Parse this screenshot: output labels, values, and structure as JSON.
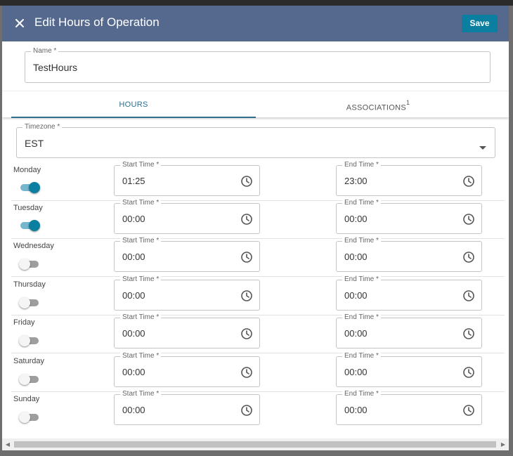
{
  "dialog": {
    "title": "Edit Hours of Operation",
    "save_label": "Save",
    "close_icon": "close-icon"
  },
  "name_field": {
    "label": "Name *",
    "value": "TestHours"
  },
  "tabs": [
    {
      "label": "HOURS",
      "active": true,
      "badge": ""
    },
    {
      "label": "ASSOCIATIONS",
      "active": false,
      "badge": "1"
    }
  ],
  "timezone": {
    "label": "Timezone *",
    "value": "EST"
  },
  "field_labels": {
    "start": "Start Time *",
    "end": "End Time *"
  },
  "days": [
    {
      "name": "Monday",
      "enabled": true,
      "start": "01:25",
      "end": "23:00"
    },
    {
      "name": "Tuesday",
      "enabled": true,
      "start": "00:00",
      "end": "00:00"
    },
    {
      "name": "Wednesday",
      "enabled": false,
      "start": "00:00",
      "end": "00:00"
    },
    {
      "name": "Thursday",
      "enabled": false,
      "start": "00:00",
      "end": "00:00"
    },
    {
      "name": "Friday",
      "enabled": false,
      "start": "00:00",
      "end": "00:00"
    },
    {
      "name": "Saturday",
      "enabled": false,
      "start": "00:00",
      "end": "00:00"
    },
    {
      "name": "Sunday",
      "enabled": false,
      "start": "00:00",
      "end": "00:00"
    }
  ],
  "colors": {
    "header": "#54698d",
    "accent": "#0a7fa0",
    "tab_active": "#2f6e8f"
  }
}
